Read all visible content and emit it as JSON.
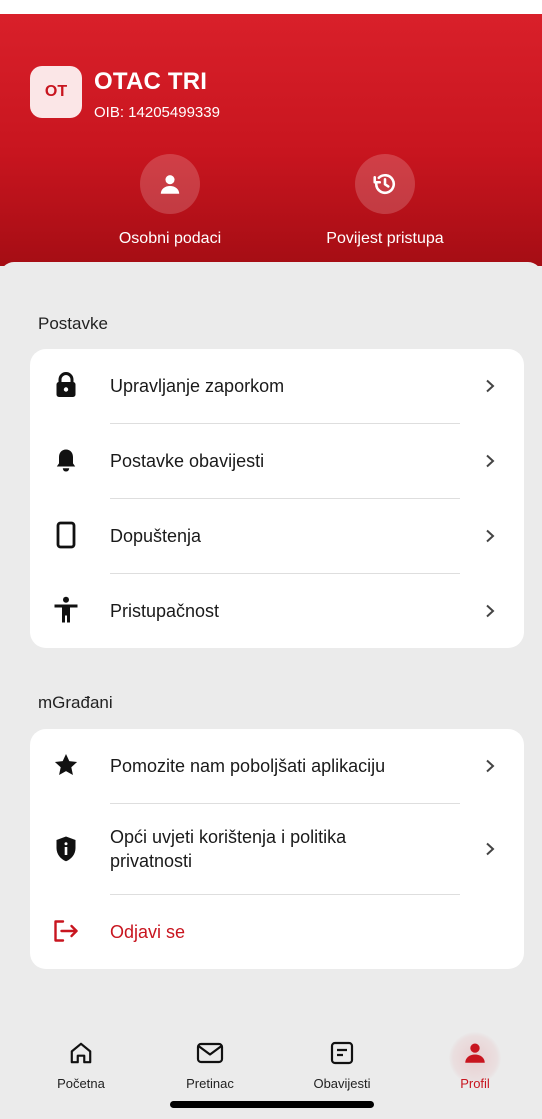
{
  "user": {
    "initials": "OT",
    "name": "OTAC TRI",
    "oib": "OIB: 14205499339"
  },
  "quick_actions": [
    {
      "label": "Osobni podaci",
      "icon": "person-icon"
    },
    {
      "label": "Povijest pristupa",
      "icon": "history-icon"
    }
  ],
  "sections": {
    "settings": {
      "title": "Postavke",
      "items": [
        {
          "label": "Upravljanje zaporkom",
          "icon": "lock-icon"
        },
        {
          "label": "Postavke obavijesti",
          "icon": "bell-icon"
        },
        {
          "label": "Dopuštenja",
          "icon": "phone-icon"
        },
        {
          "label": "Pristupačnost",
          "icon": "accessibility-icon"
        }
      ]
    },
    "app": {
      "title": "mGrađani",
      "items": [
        {
          "label": "Pomozite nam poboljšati aplikaciju",
          "icon": "star-icon"
        },
        {
          "label": "Opći uvjeti korištenja i politika",
          "label_line2": "privatnosti",
          "icon": "shield-icon"
        },
        {
          "label": "Odjavi se",
          "icon": "logout-icon"
        }
      ]
    }
  },
  "tabs": [
    {
      "label": "Početna",
      "icon": "home-icon"
    },
    {
      "label": "Pretinac",
      "icon": "mail-icon"
    },
    {
      "label": "Obavijesti",
      "icon": "notifications-icon"
    },
    {
      "label": "Profil",
      "icon": "profile-icon",
      "active": true
    }
  ],
  "colors": {
    "brand": "#c8151f",
    "logout": "#c8151f",
    "background": "#ebebeb",
    "card": "#ffffff"
  }
}
